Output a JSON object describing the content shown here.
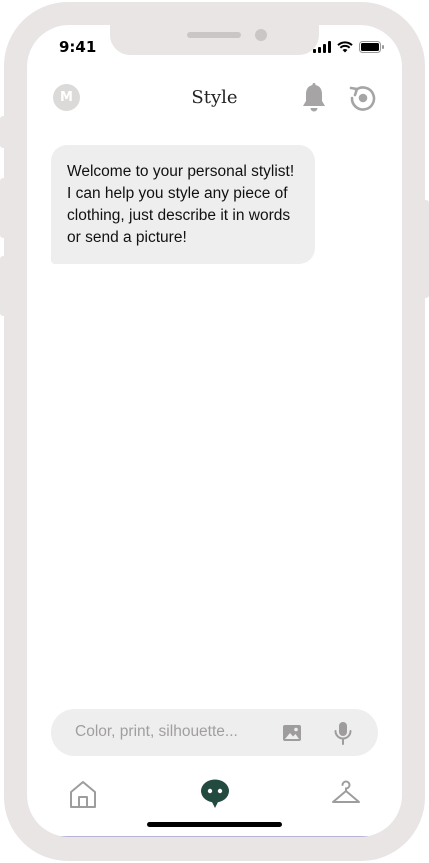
{
  "status_bar": {
    "time": "9:41"
  },
  "header": {
    "avatar_initial": "M",
    "title": "Style",
    "icons": [
      "bell-icon",
      "reload-icon"
    ]
  },
  "chat": {
    "messages": [
      {
        "sender": "assistant",
        "text": "Welcome to your personal stylist! I can help you style any piece of clothing, just describe it in words or send a picture!"
      }
    ]
  },
  "composer": {
    "placeholder": "Color, print, silhouette...",
    "icons": [
      "image-icon",
      "microphone-icon"
    ]
  },
  "bottom_nav": {
    "items": [
      {
        "name": "home",
        "icon": "home-icon",
        "active": false
      },
      {
        "name": "chat",
        "icon": "chat-icon",
        "active": true
      },
      {
        "name": "closet",
        "icon": "hanger-icon",
        "active": false
      }
    ]
  },
  "colors": {
    "frame": "#e8e5e4",
    "bubble": "#efeeee",
    "active_nav": "#234a3f",
    "inactive_icon": "#9e9c9c"
  }
}
